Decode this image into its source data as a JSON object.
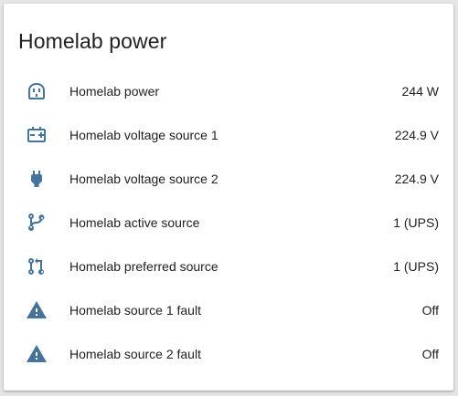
{
  "card": {
    "title": "Homelab power"
  },
  "entities": [
    {
      "icon": "power-socket-icon",
      "name": "Homelab power",
      "state": "244 W"
    },
    {
      "icon": "battery-charging-icon",
      "name": "Homelab voltage source 1",
      "state": "224.9 V"
    },
    {
      "icon": "power-plug-icon",
      "name": "Homelab voltage source 2",
      "state": "224.9 V"
    },
    {
      "icon": "source-branch-icon",
      "name": "Homelab active source",
      "state": "1 (UPS)"
    },
    {
      "icon": "source-pull-icon",
      "name": "Homelab preferred source",
      "state": "1 (UPS)"
    },
    {
      "icon": "alert-icon",
      "name": "Homelab source 1 fault",
      "state": "Off"
    },
    {
      "icon": "alert-icon",
      "name": "Homelab source 2 fault",
      "state": "Off"
    }
  ],
  "colors": {
    "icon": "#44739e",
    "text": "#212121",
    "background": "#ffffff"
  }
}
